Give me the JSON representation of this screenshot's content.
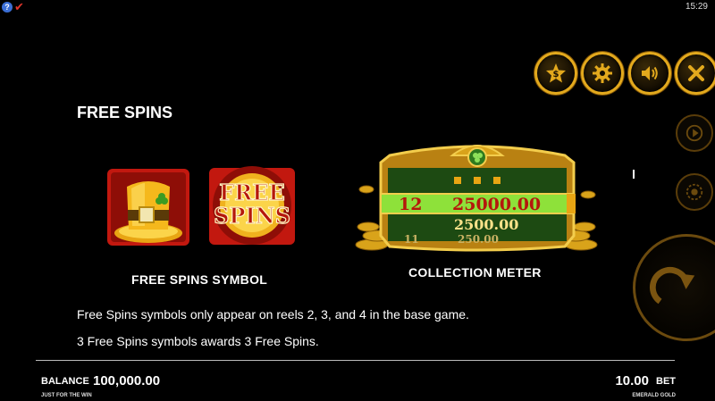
{
  "status_bar": {
    "help_glyph": "?",
    "check_glyph": "✔",
    "time": "15:29"
  },
  "controls": {
    "buy_icon": "dollar-star-icon",
    "settings_icon": "gear-icon",
    "sound_icon": "speaker-icon",
    "close_icon": "close-icon",
    "autoplay_icon": "autoplay-icon",
    "coin_icon": "coin-stack-icon",
    "spin_icon": "spin-arrow-icon"
  },
  "page": {
    "title": "FREE SPINS",
    "symbol_text_line1": "FREE",
    "symbol_text_line2": "SPINS",
    "free_spins_symbol_label": "FREE SPINS SYMBOL",
    "collection_meter_label": "COLLECTION METER",
    "meter": {
      "active_row": {
        "count": "12",
        "amount": "25000.00"
      },
      "row_below": {
        "amount": "2500.00"
      },
      "row_bottom": {
        "count": "11",
        "amount": "250.00"
      }
    },
    "desc_line1": "Free Spins symbols only appear on reels 2, 3, and 4 in the base game.",
    "desc_line2": "3 Free Spins symbols awards 3 Free Spins."
  },
  "footer": {
    "balance_label": "BALANCE",
    "balance_value": "100,000.00",
    "balance_sub": "JUST FOR THE WIN",
    "bet_value": "10.00",
    "bet_label": "BET",
    "bet_sub": "EMERALD GOLD"
  },
  "colors": {
    "gold": "#e3a91d",
    "dark_gold": "#7a4f06",
    "green": "#2f7a1e",
    "red": "#c2180f"
  }
}
